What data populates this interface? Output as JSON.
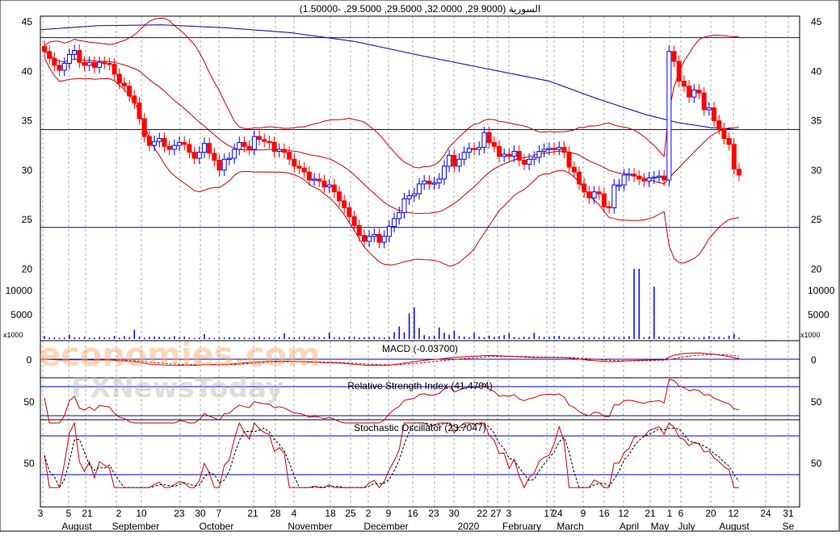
{
  "chart_data": {
    "type": "candlestick",
    "title": "السورية (29.9000, 32.0000, 29.5000, 29.5000, -1.50000)",
    "colors": {
      "down": "#ff0000",
      "up": "#0000ff",
      "bands": "#cc0000",
      "ma": "#0000bb",
      "line": "#0000cc",
      "grid": "#a8a8a8"
    },
    "price_axis": {
      "ylim": [
        17.8,
        47.5
      ],
      "ticks": [
        "45",
        "40",
        "35",
        "30",
        "25",
        "20"
      ],
      "tick_values": [
        45,
        40,
        35,
        30,
        25,
        20
      ],
      "hlines": [
        43.4,
        34.1,
        24.2
      ]
    },
    "volume_axis": {
      "ylim": [
        0,
        15500
      ],
      "ticks": [
        "10000",
        "5000"
      ],
      "tick_values": [
        10000,
        5000
      ],
      "unit_label": "x1000"
    },
    "price_series": [
      42,
      41.3,
      40.6,
      40.1,
      40.8,
      41.7,
      42.1,
      40.9,
      40.6,
      40.9,
      40.4,
      40.9,
      40.8,
      40.7,
      39.7,
      38.8,
      38.5,
      37.5,
      36.8,
      35.2,
      33.4,
      32.5,
      32.9,
      33.2,
      32.4,
      32.1,
      32.5,
      32.8,
      32.6,
      31.8,
      31.2,
      31.8,
      32.7,
      31.7,
      31,
      30,
      31.1,
      31.2,
      32.1,
      32.8,
      32.4,
      32.1,
      33.4,
      33.1,
      32.9,
      32.8,
      31.9,
      32.1,
      31.8,
      31.1,
      30.4,
      30.2,
      29.8,
      29,
      29.1,
      28.9,
      28.3,
      28.5,
      27.8,
      26.9,
      26.2,
      25.3,
      24.4,
      23.4,
      22.8,
      23.3,
      23.5,
      22.7,
      23.3,
      24.3,
      25.1,
      25.7,
      27.1,
      27.4,
      27.6,
      28.6,
      28.9,
      28.6,
      28.7,
      29.1,
      30.4,
      31.5,
      30.4,
      31.1,
      31.8,
      32.2,
      32.1,
      32.3,
      33.8,
      32.8,
      32.4,
      31.4,
      31.6,
      31.4,
      31.9,
      31,
      30.6,
      31.1,
      31.3,
      31.9,
      32.1,
      32.2,
      32.1,
      32.3,
      31.8,
      30.3,
      29.8,
      28.6,
      27.8,
      27.2,
      27.8,
      27.6,
      26.3,
      26.2,
      28.5,
      28.5,
      29.5,
      29.6,
      29.4,
      29.1,
      28.9,
      29.2,
      29.3,
      29.4,
      29,
      42,
      41,
      39,
      38.5,
      37.4,
      38.1,
      37.8,
      36.1,
      36.3,
      35,
      34.2,
      33.2,
      32.6,
      30.1,
      29.5
    ],
    "volume_series": [
      600,
      300,
      400,
      250,
      300,
      900,
      350,
      300,
      450,
      300,
      300,
      400,
      350,
      300,
      650,
      300,
      600,
      400,
      1900,
      500,
      300,
      450,
      500,
      450,
      400,
      350,
      600,
      350,
      500,
      300,
      250,
      300,
      1000,
      300,
      250,
      350,
      300,
      400,
      350,
      300,
      300,
      250,
      350,
      500,
      300,
      300,
      250,
      400,
      1200,
      350,
      300,
      400,
      500,
      300,
      450,
      350,
      400,
      1300,
      350,
      400,
      300,
      500,
      450,
      300,
      350,
      400,
      500,
      350,
      300,
      450,
      1400,
      2600,
      1400,
      5300,
      6500,
      2300,
      800,
      550,
      700,
      2400,
      1300,
      900,
      1700,
      600,
      500,
      350,
      1300,
      500,
      400,
      700,
      450,
      600,
      800,
      1200,
      400,
      300,
      500,
      450,
      1300,
      550,
      400,
      450,
      600,
      650,
      400,
      450,
      300,
      500,
      350,
      400,
      450,
      300,
      500,
      350,
      500,
      400,
      450,
      600,
      14500,
      14500,
      350,
      500,
      10800,
      500,
      400,
      350,
      400,
      450,
      500,
      400,
      350,
      300,
      450,
      600,
      400,
      500,
      300,
      700,
      1100,
      300,
      400,
      350,
      400
    ],
    "macd": {
      "label": "MACD (-0.03700)",
      "tick": "0",
      "ylim": [
        -0.6,
        0.6
      ]
    },
    "rsi": {
      "label": "Relative Strength Index (41.4704)",
      "tick": "50",
      "ylim": [
        0,
        100
      ],
      "levels": [
        70,
        30
      ]
    },
    "stochastic": {
      "label": "Stochastic Oscillator (23.7047)",
      "tick": "50",
      "ylim": [
        0,
        100
      ],
      "levels": [
        80,
        20
      ]
    },
    "x_days": [
      "3",
      "5",
      "21",
      "2",
      "10",
      "23",
      "30",
      "7",
      "21",
      "28",
      "4",
      "18",
      "25",
      "2",
      "9",
      "16",
      "23",
      "30",
      "22",
      "27",
      "3",
      "17",
      "24",
      "9",
      "16",
      "12",
      "21",
      "1",
      "6",
      "20",
      "12",
      "24",
      "31"
    ],
    "x_months": [
      "August",
      "September",
      "October",
      "November",
      "December",
      "2020",
      "February",
      "March",
      "April",
      "May",
      "July",
      "August",
      "Se"
    ]
  },
  "watermark": {
    "line1": "economies.com",
    "line2": "FXNewsToday"
  }
}
